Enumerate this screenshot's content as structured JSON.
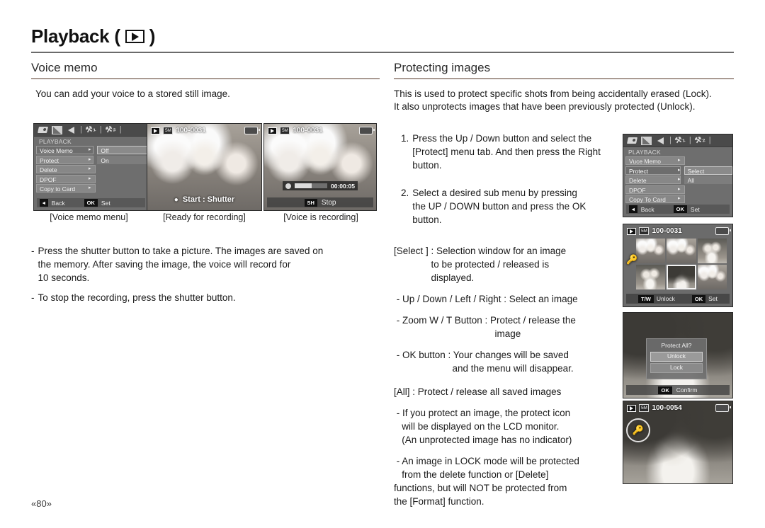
{
  "header": {
    "title": "Playback",
    "paren_open": "(",
    "paren_close": ")",
    "play_icon": "play-icon"
  },
  "left": {
    "section_title": "Voice memo",
    "intro": "You can add your voice to a stored still image.",
    "captions": [
      "[Voice memo menu]",
      "[Ready for recording]",
      "[Voice is recording]"
    ],
    "notes": [
      {
        "dash": "-",
        "text": "Press the shutter button to take a picture. The images are saved on\nthe memory. After saving the image, the voice will record for\n10 seconds."
      },
      {
        "dash": "-",
        "text": "To stop the recording, press the shutter button."
      }
    ]
  },
  "right": {
    "section_title": "Protecting images",
    "intro_line1": "This is used to protect specific shots from being accidentally erased (Lock).",
    "intro_line2": "It also unprotects images that have been previously protected (Unlock).",
    "steps": [
      {
        "num": "1.",
        "text": "Press the Up / Down button and select the\n[Protect] menu tab. And then press the Right\nbutton."
      },
      {
        "num": "2.",
        "text": "Select a desired sub menu by pressing\nthe UP / DOWN button and press the OK\nbutton."
      }
    ],
    "bullets": [
      {
        "l1": "[Select ] : Selection window for an image",
        "l2": "              to be protected / released is",
        "l3": "              displayed."
      },
      {
        "l1": " - Up / Down / Left / Right : Select an image",
        "l2": "",
        "l3": ""
      },
      {
        "l1": " - Zoom W / T Button : Protect / release the",
        "l2": "                                      image",
        "l3": ""
      },
      {
        "l1": " - OK button : Your changes will be saved",
        "l2": "                      and the menu will disappear.",
        "l3": ""
      },
      {
        "l1": "[All] : Protect / release all saved images",
        "l2": "",
        "l3": ""
      },
      {
        "l1": " - If you protect an image, the protect icon",
        "l2": "   will be displayed on the LCD monitor.",
        "l3": "   (An unprotected image has no indicator)"
      },
      {
        "l1": " - An image in LOCK mode will be protected",
        "l2": "   from the delete function or [Delete]",
        "l3": "   functions, but will NOT be protected from\n   the [Format] function."
      }
    ]
  },
  "lcd": {
    "voice_menu": {
      "heading": "PLAYBACK",
      "tabs": [
        "camera-icon",
        "playback-icon",
        "speaker-icon",
        "setup1-icon",
        "setup2-icon"
      ],
      "rows": [
        {
          "label": "Voice Memo",
          "arrow": "▸",
          "highlight": true
        },
        {
          "label": "Protect",
          "arrow": "▸",
          "highlight": false
        },
        {
          "label": "Delete",
          "arrow": "▸",
          "highlight": false
        },
        {
          "label": "DPOF",
          "arrow": "▸",
          "highlight": false
        },
        {
          "label": "Copy to Card",
          "arrow": "▸",
          "highlight": false
        }
      ],
      "submenu": [
        {
          "text": "Off",
          "selected": true
        },
        {
          "text": "On",
          "selected": false
        }
      ],
      "bottom": {
        "back_key": "◂",
        "back_label": "Back",
        "ok_key": "OK",
        "ok_label": "Set"
      }
    },
    "ready": {
      "file": "100-0031",
      "res_badge": "5M",
      "hint": "Start : Shutter",
      "mic_icon": "microphone-icon",
      "play_icon": "playback-icon",
      "battery_icon": "battery-icon"
    },
    "recording": {
      "file": "100-0031",
      "res_badge": "5M",
      "time": "00:00:05",
      "stop_key": "SH",
      "stop_label": "Stop",
      "rec_icon": "record-dot-icon"
    },
    "protect_menu": {
      "heading": "PLAYBACK",
      "rows": [
        {
          "label": "Vuce Memo",
          "arrow": "▸",
          "highlight": false
        },
        {
          "label": "Protect",
          "arrow": "▸",
          "highlight": true
        },
        {
          "label": "Delete",
          "arrow": "▸",
          "highlight": false
        },
        {
          "label": "DPOF",
          "arrow": "▸",
          "highlight": false
        },
        {
          "label": "Copy To Card",
          "arrow": "▸",
          "highlight": false
        }
      ],
      "submenu": [
        {
          "text": "Select",
          "selected": true
        },
        {
          "text": "All",
          "selected": false
        }
      ],
      "bottom": {
        "back_key": "◂",
        "back_label": "Back",
        "ok_key": "OK",
        "ok_label": "Set"
      }
    },
    "select_window": {
      "file": "100-0031",
      "res_badge": "5M",
      "tw_key": "T/W",
      "tw_label": "Unlock",
      "ok_key": "OK",
      "ok_label": "Set",
      "lock_icon": "key-lock-icon"
    },
    "protect_all": {
      "title": "Protect All?",
      "options": [
        "Unlock",
        "Lock"
      ],
      "ok_key": "OK",
      "ok_label": "Confirm"
    },
    "locked_image": {
      "file": "100-0054",
      "res_badge": "5M",
      "lock_icon": "key-lock-icon"
    }
  },
  "footer": {
    "page": "«80»"
  }
}
